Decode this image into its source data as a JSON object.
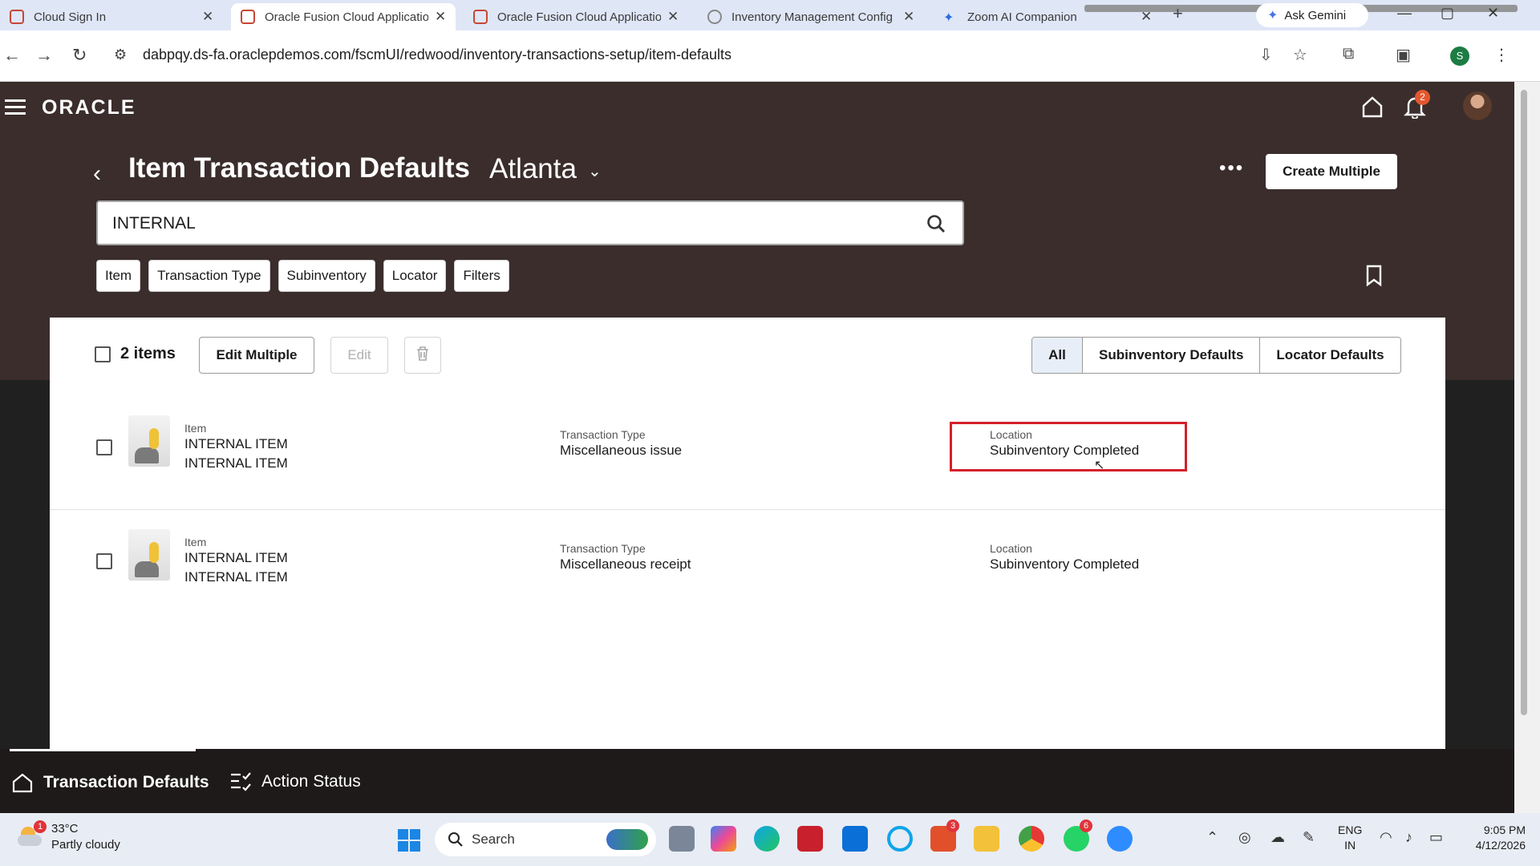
{
  "browser": {
    "tabs": [
      {
        "title": "Cloud Sign In",
        "icon": "oracle-icon"
      },
      {
        "title": "Oracle Fusion Cloud Applicatio",
        "icon": "oracle-icon",
        "active": true
      },
      {
        "title": "Oracle Fusion Cloud Applicatio",
        "icon": "oracle-icon"
      },
      {
        "title": "Inventory Management Config",
        "icon": "globe-icon"
      },
      {
        "title": "Zoom AI Companion",
        "icon": "sparkle-icon"
      }
    ],
    "gemini_label": "Ask Gemini",
    "url": "dabpqy.ds-fa.oraclepdemos.com/fscmUI/redwood/inventory-transactions-setup/item-defaults",
    "profile_initial": "S"
  },
  "app": {
    "logo": "ORACLE",
    "notification_count": "2"
  },
  "page": {
    "title": "Item Transaction Defaults",
    "location": "Atlanta",
    "create_button": "Create Multiple",
    "search_value": "INTERNAL",
    "filter_chips": [
      "Item",
      "Transaction Type",
      "Subinventory",
      "Locator",
      "Filters"
    ]
  },
  "list": {
    "count_label": "2 items",
    "edit_multiple": "Edit Multiple",
    "edit": "Edit",
    "segments": [
      "All",
      "Subinventory Defaults",
      "Locator Defaults"
    ],
    "rows": [
      {
        "item_label": "Item",
        "item_name": "INTERNAL ITEM",
        "item_desc": "INTERNAL ITEM",
        "type_label": "Transaction Type",
        "type_value": "Miscellaneous issue",
        "location_label": "Location",
        "location_value": "Subinventory Completed"
      },
      {
        "item_label": "Item",
        "item_name": "INTERNAL ITEM",
        "item_desc": "INTERNAL ITEM",
        "type_label": "Transaction Type",
        "type_value": "Miscellaneous receipt",
        "location_label": "Location",
        "location_value": "Subinventory Completed"
      }
    ]
  },
  "bottom_nav": {
    "items": [
      "Transaction Defaults",
      "Action Status"
    ]
  },
  "taskbar": {
    "weather_badge": "1",
    "temperature": "33°C",
    "condition": "Partly cloudy",
    "search_placeholder": "Search",
    "badge_l": "3",
    "badge_whatsapp": "6",
    "lang_line1": "ENG",
    "lang_line2": "IN",
    "time": "9:05 PM",
    "date": "4/12/2026"
  },
  "colors": {
    "header_bg": "#3a2d2c",
    "highlight_border": "#d3202a",
    "segment_selected": "#e7eef7"
  }
}
